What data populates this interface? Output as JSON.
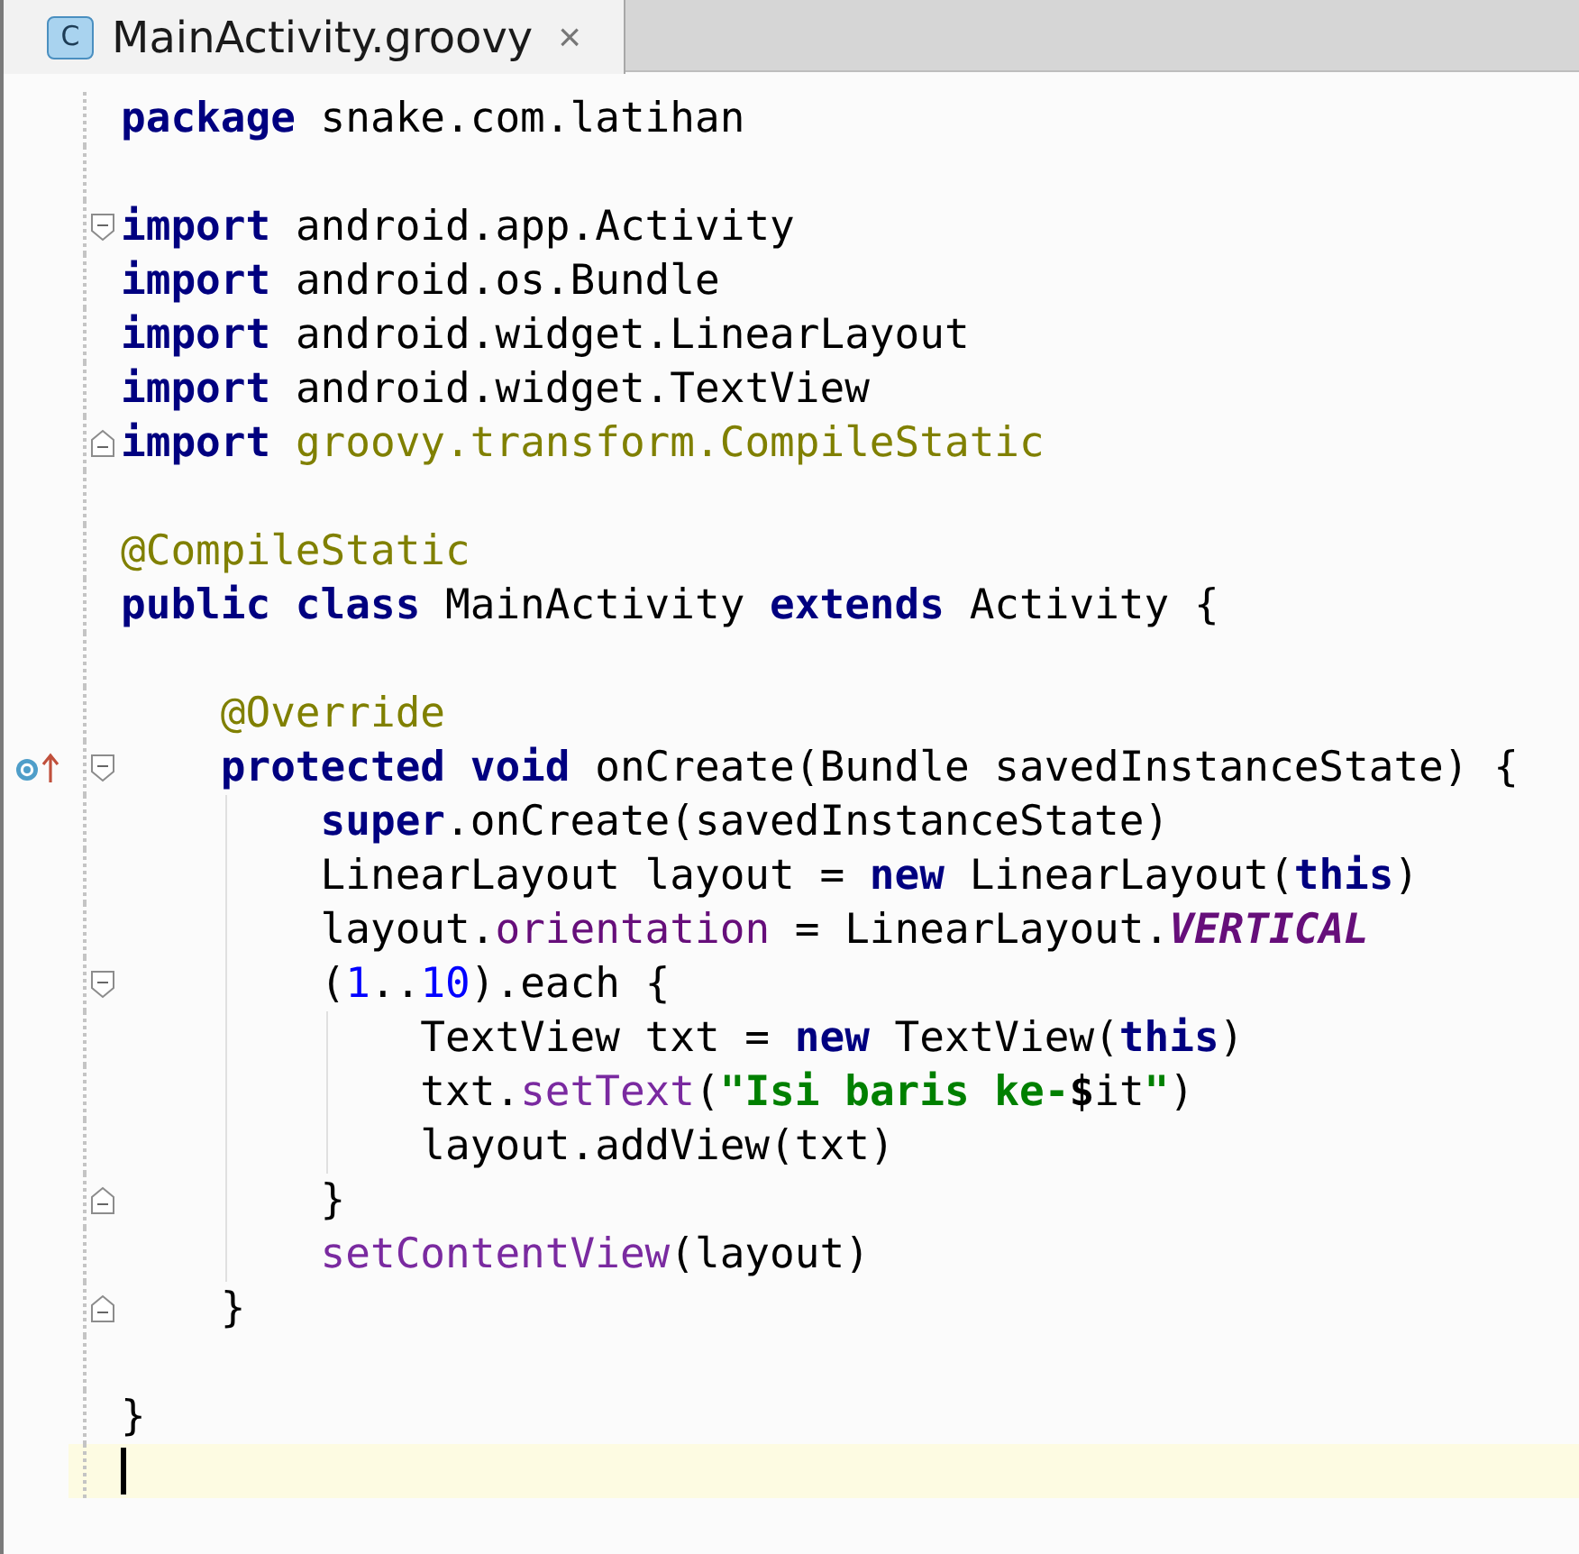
{
  "tab": {
    "icon_letter": "C",
    "title": "MainActivity.groovy",
    "close": "×",
    "selected": true
  },
  "lines": [
    {
      "tokens": [
        {
          "text": "package",
          "kind": "keyword"
        },
        {
          "text": " snake.com.latihan",
          "kind": "plain"
        }
      ]
    },
    {
      "gap_before": true,
      "fold_start": true,
      "tokens": [
        {
          "text": "import",
          "kind": "keyword"
        },
        {
          "text": " android.app.Activity",
          "kind": "plain"
        }
      ]
    },
    {
      "tokens": [
        {
          "text": "import",
          "kind": "keyword"
        },
        {
          "text": " android.os.Bundle",
          "kind": "plain"
        }
      ]
    },
    {
      "tokens": [
        {
          "text": "import",
          "kind": "keyword"
        },
        {
          "text": " android.widget.LinearLayout",
          "kind": "plain"
        }
      ]
    },
    {
      "tokens": [
        {
          "text": "import",
          "kind": "keyword"
        },
        {
          "text": " android.widget.TextView",
          "kind": "plain"
        }
      ]
    },
    {
      "fold_end": true,
      "tokens": [
        {
          "text": "import",
          "kind": "keyword"
        },
        {
          "text": " groovy.transform.CompileStatic",
          "kind": "unused"
        }
      ]
    },
    {
      "gap_before": true,
      "tokens": [
        {
          "text": "@CompileStatic",
          "kind": "annotation"
        }
      ]
    },
    {
      "tokens": [
        {
          "text": "public class",
          "kind": "keyword"
        },
        {
          "text": " MainActivity ",
          "kind": "plain"
        },
        {
          "text": "extends",
          "kind": "keyword"
        },
        {
          "text": " Activity {",
          "kind": "plain"
        }
      ]
    },
    {
      "gap_before": true,
      "tokens": [
        {
          "text": "    @Override",
          "kind": "annotation"
        }
      ]
    },
    {
      "override": true,
      "fold_start": true,
      "tokens": [
        {
          "text": "    protected void",
          "kind": "keyword"
        },
        {
          "text": " onCreate(Bundle savedInstanceState) {",
          "kind": "plain"
        }
      ]
    },
    {
      "tokens": [
        {
          "text": "        super",
          "kind": "keyword"
        },
        {
          "text": ".onCreate(savedInstanceState)",
          "kind": "plain"
        }
      ]
    },
    {
      "tokens": [
        {
          "text": "        LinearLayout layout = ",
          "kind": "plain"
        },
        {
          "text": "new",
          "kind": "keyword"
        },
        {
          "text": " LinearLayout(",
          "kind": "plain"
        },
        {
          "text": "this",
          "kind": "keyword"
        },
        {
          "text": ")",
          "kind": "plain"
        }
      ]
    },
    {
      "tokens": [
        {
          "text": "        layout.",
          "kind": "plain"
        },
        {
          "text": "orientation",
          "kind": "field"
        },
        {
          "text": " = LinearLayout.",
          "kind": "plain"
        },
        {
          "text": "VERTICAL",
          "kind": "constant"
        }
      ]
    },
    {
      "fold_start": true,
      "tokens": [
        {
          "text": "        (",
          "kind": "plain"
        },
        {
          "text": "1",
          "kind": "number"
        },
        {
          "text": "..",
          "kind": "plain"
        },
        {
          "text": "10",
          "kind": "number"
        },
        {
          "text": ").each {",
          "kind": "plain"
        }
      ]
    },
    {
      "tokens": [
        {
          "text": "            TextView txt = ",
          "kind": "plain"
        },
        {
          "text": "new",
          "kind": "keyword"
        },
        {
          "text": " TextView(",
          "kind": "plain"
        },
        {
          "text": "this",
          "kind": "keyword"
        },
        {
          "text": ")",
          "kind": "plain"
        }
      ]
    },
    {
      "tokens": [
        {
          "text": "            txt.",
          "kind": "plain"
        },
        {
          "text": "setText",
          "kind": "method"
        },
        {
          "text": "(",
          "kind": "plain"
        },
        {
          "text": "\"Isi baris ke-",
          "kind": "string"
        },
        {
          "text": "$",
          "kind": "interp"
        },
        {
          "text": "it",
          "kind": "plain"
        },
        {
          "text": "\"",
          "kind": "string"
        },
        {
          "text": ")",
          "kind": "plain"
        }
      ]
    },
    {
      "tokens": [
        {
          "text": "            layout.addView(txt)",
          "kind": "plain"
        }
      ]
    },
    {
      "fold_end": true,
      "tokens": [
        {
          "text": "        }",
          "kind": "plain"
        }
      ]
    },
    {
      "tokens": [
        {
          "text": "        setContentView",
          "kind": "method"
        },
        {
          "text": "(layout)",
          "kind": "plain"
        }
      ]
    },
    {
      "fold_end": true,
      "tokens": [
        {
          "text": "    }",
          "kind": "plain"
        }
      ]
    },
    {
      "gap_before": true,
      "tokens": [
        {
          "text": "}",
          "kind": "plain"
        }
      ]
    },
    {
      "caret": true
    }
  ]
}
